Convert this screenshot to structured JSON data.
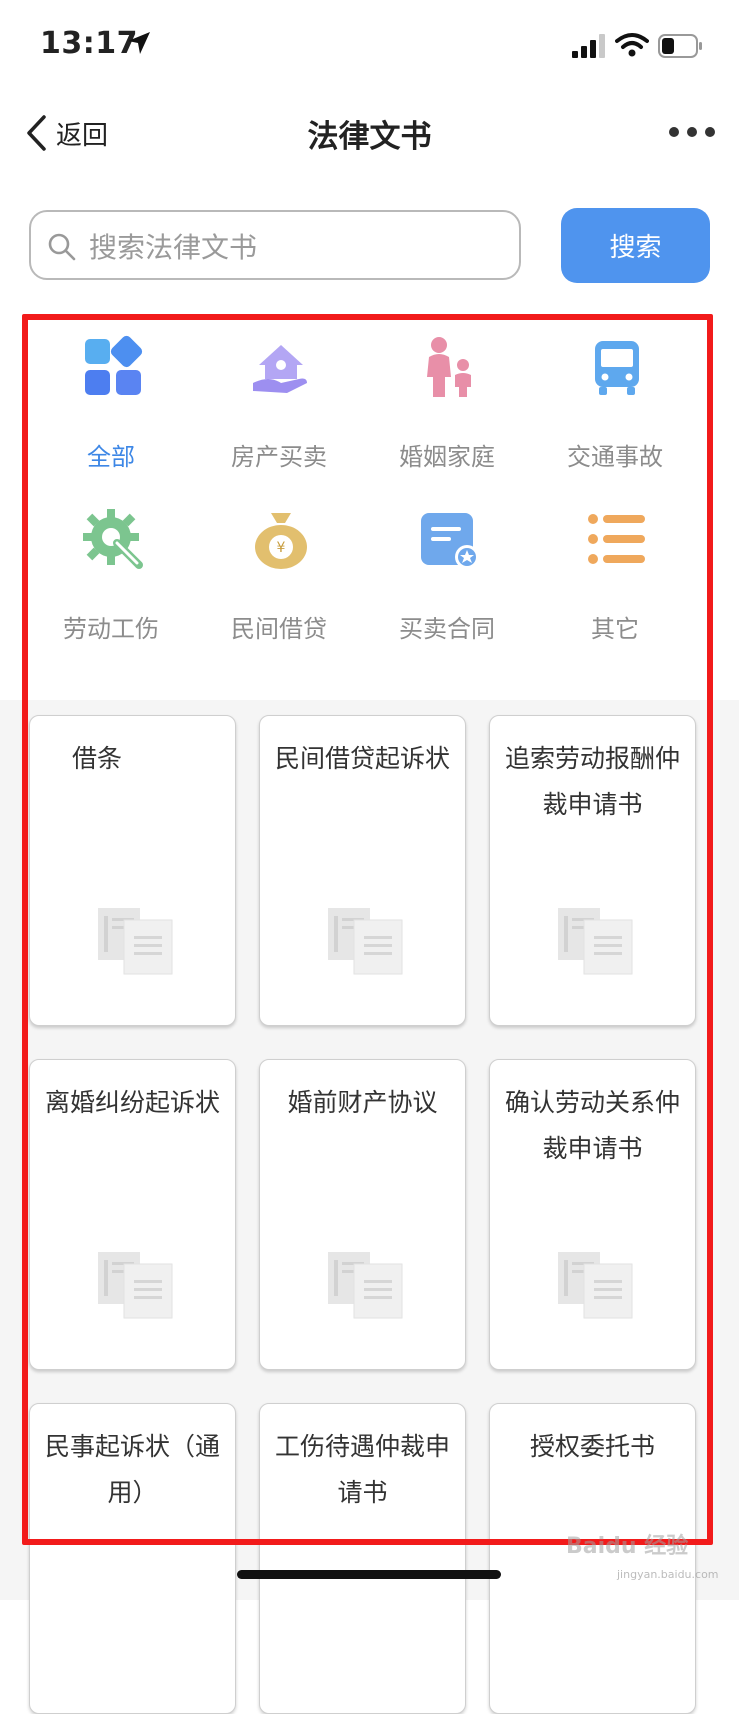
{
  "status": {
    "time": "13:17"
  },
  "nav": {
    "back_label": "返回",
    "title": "法律文书"
  },
  "search": {
    "placeholder": "搜索法律文书",
    "button_label": "搜索"
  },
  "categories": [
    {
      "label": "全部",
      "icon": "grid-icon",
      "color": "#4d8ff0",
      "active": true
    },
    {
      "label": "房产买卖",
      "icon": "house-hand-icon",
      "color": "#a99cf2",
      "active": false
    },
    {
      "label": "婚姻家庭",
      "icon": "family-icon",
      "color": "#e88fa8",
      "active": false
    },
    {
      "label": "交通事故",
      "icon": "bus-icon",
      "color": "#5ea8ee",
      "active": false
    },
    {
      "label": "劳动工伤",
      "icon": "gear-wrench-icon",
      "color": "#7cc58f",
      "active": false
    },
    {
      "label": "民间借贷",
      "icon": "money-bag-icon",
      "color": "#e2bf6e",
      "active": false
    },
    {
      "label": "买卖合同",
      "icon": "contract-icon",
      "color": "#6fa8ec",
      "active": false
    },
    {
      "label": "其它",
      "icon": "list-icon",
      "color": "#efa85c",
      "active": false
    }
  ],
  "documents": [
    {
      "title": "借条",
      "icon": "document-icon"
    },
    {
      "title": "民间借贷起诉状",
      "icon": "document-icon"
    },
    {
      "title": "追索劳动报酬仲裁申请书",
      "icon": "document-icon"
    },
    {
      "title": "离婚纠纷起诉状",
      "icon": "document-icon"
    },
    {
      "title": "婚前财产协议",
      "icon": "document-icon"
    },
    {
      "title": "确认劳动关系仲裁申请书",
      "icon": "document-icon"
    },
    {
      "title": "民事起诉状（通用）",
      "icon": "document-icon"
    },
    {
      "title": "工伤待遇仲裁申请书",
      "icon": "document-icon"
    },
    {
      "title": "授权委托书",
      "icon": "document-icon"
    }
  ],
  "watermark": {
    "text": "Baidu 经验",
    "sub": "jingyan.baidu.com"
  }
}
